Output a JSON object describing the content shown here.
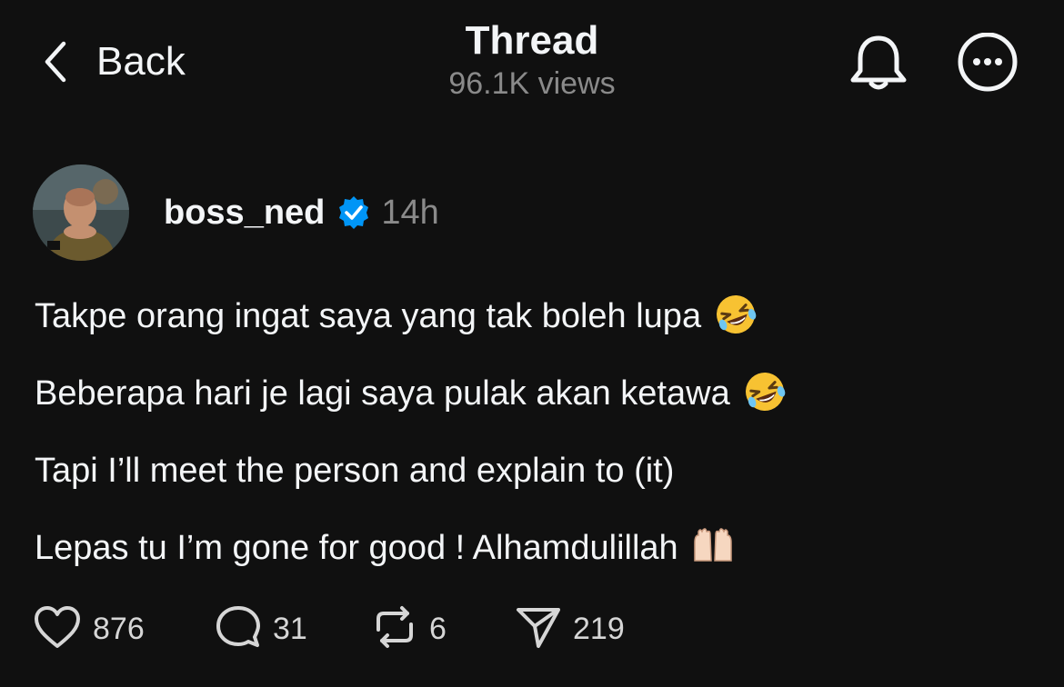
{
  "header": {
    "back_label": "Back",
    "title": "Thread",
    "views": "96.1K views"
  },
  "author": {
    "username": "boss_ned",
    "verified": true,
    "time": "14h"
  },
  "post": {
    "lines": [
      "Takpe orang ingat saya yang tak boleh lupa",
      "Beberapa hari je lagi saya pulak akan ketawa",
      "Tapi I’ll meet the person and explain to (it)",
      "Lepas tu I’m gone for good ! Alhamdulillah"
    ],
    "line_emojis": [
      "rolling-laughing-emoji",
      "rolling-laughing-emoji",
      "",
      "raising-hands-emoji"
    ]
  },
  "actions": {
    "likes": "876",
    "replies": "31",
    "reposts": "6",
    "shares": "219"
  },
  "colors": {
    "background": "#101010",
    "text": "#f3f5f7",
    "secondary": "#8a8a8a",
    "verified": "#0095f6"
  },
  "icons": [
    "chevron-left-icon",
    "bell-icon",
    "more-icon",
    "verified-badge-icon",
    "heart-icon",
    "comment-icon",
    "repost-icon",
    "share-icon"
  ]
}
